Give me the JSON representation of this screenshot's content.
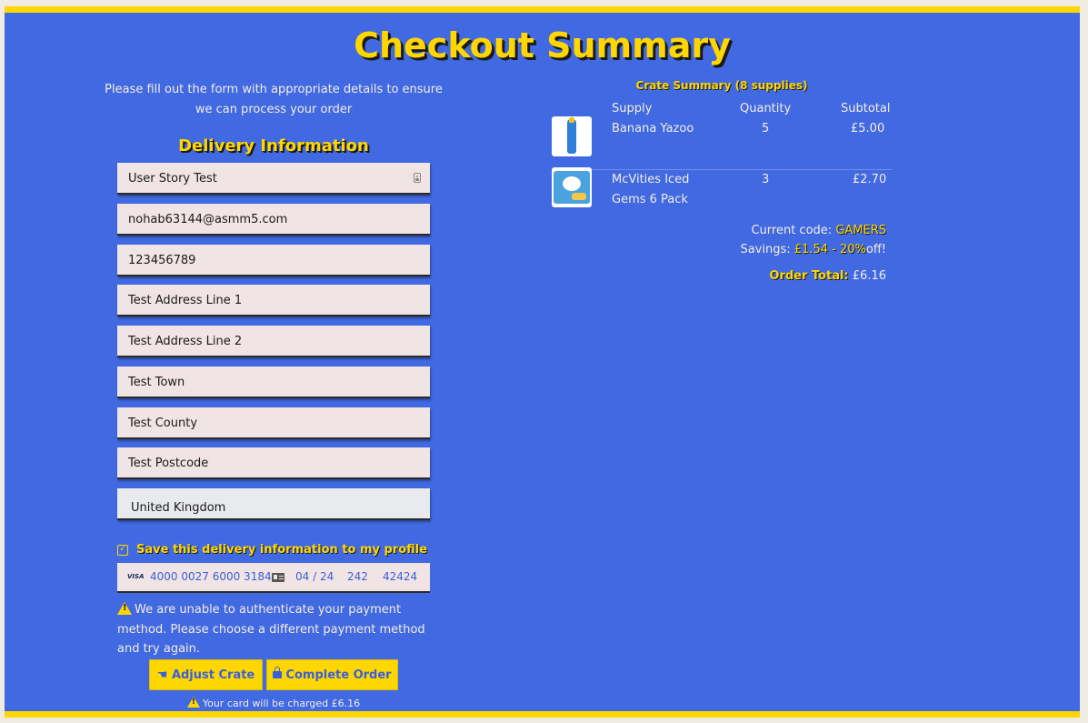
{
  "page": {
    "title": "Checkout Summary",
    "intro": "Please fill out the form with appropriate details to ensure we can process your order"
  },
  "delivery": {
    "heading": "Delivery Information",
    "fields": {
      "name": "User Story Test",
      "email": "nohab63144@asmm5.com",
      "phone": "123456789",
      "address1": "Test Address Line 1",
      "address2": "Test Address Line 2",
      "town": "Test Town",
      "county": "Test County",
      "postcode": "Test Postcode",
      "country": "United Kingdom"
    },
    "save_label": "Save this delivery information to my profile",
    "save_checked": true
  },
  "payment": {
    "brand": "VISA",
    "card_number": "4000 0027 6000 3184",
    "expiry": "04 / 24",
    "cvc": "242",
    "postal": "42424",
    "error": "We are unable to authenticate your payment method. Please choose a different payment method and try again."
  },
  "buttons": {
    "adjust": "Adjust Crate",
    "complete": "Complete Order"
  },
  "charge_note": "Your card will be charged £6.16",
  "crate": {
    "title": "Crate Summary (8 supplies)",
    "headers": {
      "supply": "Supply",
      "quantity": "Quantity",
      "subtotal": "Subtotal"
    },
    "items": [
      {
        "name": "Banana Yazoo",
        "quantity": "5",
        "subtotal": "£5.00",
        "image": "yazoo-bottle"
      },
      {
        "name_line1": "McVities Iced",
        "name_line2": "Gems 6 Pack",
        "quantity": "3",
        "subtotal": "£2.70",
        "image": "iced-gems-pack"
      }
    ],
    "code_label": "Current code:",
    "code": "GAMERS",
    "savings_label": "Savings:",
    "savings_amount": "£1.54",
    "savings_sep": "-",
    "savings_percent": "20%",
    "savings_suffix": "off!",
    "total_label": "Order Total:",
    "total": "£6.16"
  },
  "colors": {
    "background": "#4169e1",
    "accent": "#ffd700",
    "field": "#f1e4e4"
  }
}
